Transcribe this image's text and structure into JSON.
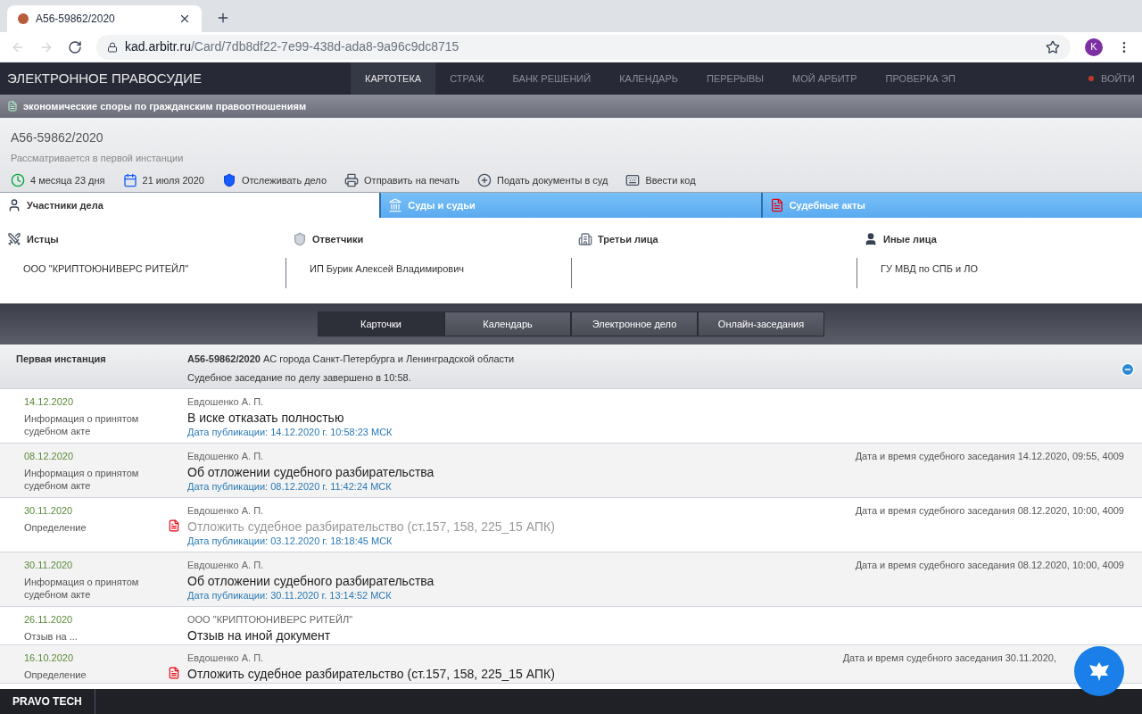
{
  "browser": {
    "tab_title": "А56-59862/2020",
    "url_host": "kad.arbitr.ru",
    "url_path": "/Card/7db8df22-7e99-438d-ada8-9a96c9dc8715",
    "avatar": "K"
  },
  "header": {
    "logo": "ЭЛЕКТРОННОЕ ПРАВОСУДИЕ",
    "nav": [
      {
        "label": "КАРТОТЕКА",
        "selected": true
      },
      {
        "label": "СТРАЖ",
        "selected": false
      },
      {
        "label": "БАНК РЕШЕНИЙ",
        "selected": false
      },
      {
        "label": "КАЛЕНДАРЬ",
        "selected": false
      },
      {
        "label": "ПЕРЕРЫВЫ",
        "selected": false
      },
      {
        "label": "МОЙ АРБИТР",
        "selected": false
      },
      {
        "label": "ПРОВЕРКА ЭП",
        "selected": false
      }
    ],
    "login": "ВОЙТИ"
  },
  "category": "экономические споры по гражданским правоотношениям",
  "case": {
    "number": "А56-59862/2020",
    "status": "Рассматривается в первой инстанции",
    "actions": [
      {
        "kind": "duration",
        "label": "4 месяца 23 дня"
      },
      {
        "kind": "date",
        "label": "21 июля 2020"
      },
      {
        "kind": "track",
        "label": "Отслеживать дело"
      },
      {
        "kind": "print",
        "label": "Отправить на печать"
      },
      {
        "kind": "submit",
        "label": "Подать документы в суд"
      },
      {
        "kind": "code",
        "label": "Ввести код"
      }
    ]
  },
  "info_tabs": [
    {
      "kind": "participants",
      "label": "Участники дела",
      "selected": true
    },
    {
      "kind": "courts",
      "label": "Суды и судьи",
      "selected": false
    },
    {
      "kind": "acts",
      "label": "Судебные акты",
      "selected": false
    }
  ],
  "participants": [
    {
      "kind": "plaintiffs",
      "title": "Истцы",
      "names": [
        "ООО \"КРИПТОЮНИВЕРС РИТЕЙЛ\""
      ]
    },
    {
      "kind": "defendants",
      "title": "Ответчики",
      "names": [
        "ИП Бурик Алексей Владимирович"
      ]
    },
    {
      "kind": "third",
      "title": "Третьи лица"
    },
    {
      "kind": "other",
      "title": "Иные лица",
      "names": [
        "ГУ МВД по СПБ и ЛО"
      ]
    }
  ],
  "view_tabs": [
    {
      "label": "Карточки",
      "selected": true
    },
    {
      "label": "Календарь",
      "selected": false
    },
    {
      "label": "Электронное дело",
      "selected": false
    },
    {
      "label": "Онлайн-заседания",
      "selected": false
    }
  ],
  "instance": {
    "title": "Первая инстанция",
    "case_number": "А56-59862/2020",
    "court": "АС города Санкт-Петербурга и Ленинградской области",
    "note": "Судебное заседание по делу завершено в 10:58.",
    "expanded": true
  },
  "events": [
    {
      "date": "14.12.2020",
      "type": "Информация о принятом судебном акте",
      "author": "Евдошенко А. П.",
      "title": "В иске отказать полностью",
      "has_file": false,
      "muted": false,
      "published": "Дата публикации: 14.12.2020 г. 10:58:23 МСК"
    },
    {
      "date": "08.12.2020",
      "type": "Информация о принятом судебном акте",
      "author": "Евдошенко А. П.",
      "title": "Об отложении судебного разбирательства",
      "has_file": false,
      "muted": false,
      "published": "Дата публикации: 08.12.2020 г. 11:42:24 МСК",
      "hearing": "Дата и время судебного заседания 14.12.2020, 09:55, 4009"
    },
    {
      "date": "30.11.2020",
      "type": "Определение",
      "author": "Евдошенко А. П.",
      "title": "Отложить судебное разбирательство (ст.157, 158, 225_15 АПК)",
      "has_file": true,
      "muted": true,
      "published": "Дата публикации: 03.12.2020 г. 18:18:45 МСК",
      "hearing": "Дата и время судебного заседания 08.12.2020, 10:00, 4009"
    },
    {
      "date": "30.11.2020",
      "type": "Информация о принятом судебном акте",
      "author": "Евдошенко А. П.",
      "title": "Об отложении судебного разбирательства",
      "has_file": false,
      "muted": false,
      "published": "Дата публикации: 30.11.2020 г. 13:14:52 МСК",
      "hearing": "Дата и время судебного заседания 08.12.2020, 10:00, 4009"
    },
    {
      "date": "26.11.2020",
      "type": "Отзыв на ...",
      "author": "ООО \"КРИПТОЮНИВЕРС РИТЕЙЛ\"",
      "title": "Отзыв на иной документ",
      "has_file": false,
      "muted": false
    },
    {
      "date": "16.10.2020",
      "type": "Определение",
      "author": "Евдошенко А. П.",
      "title": "Отложить судебное разбирательство (ст.157, 158, 225_15 АПК)",
      "has_file": true,
      "muted": false,
      "hearing": "Дата и время судебного заседания 30.11.2020,"
    }
  ],
  "footer": "PRAVO TECH"
}
